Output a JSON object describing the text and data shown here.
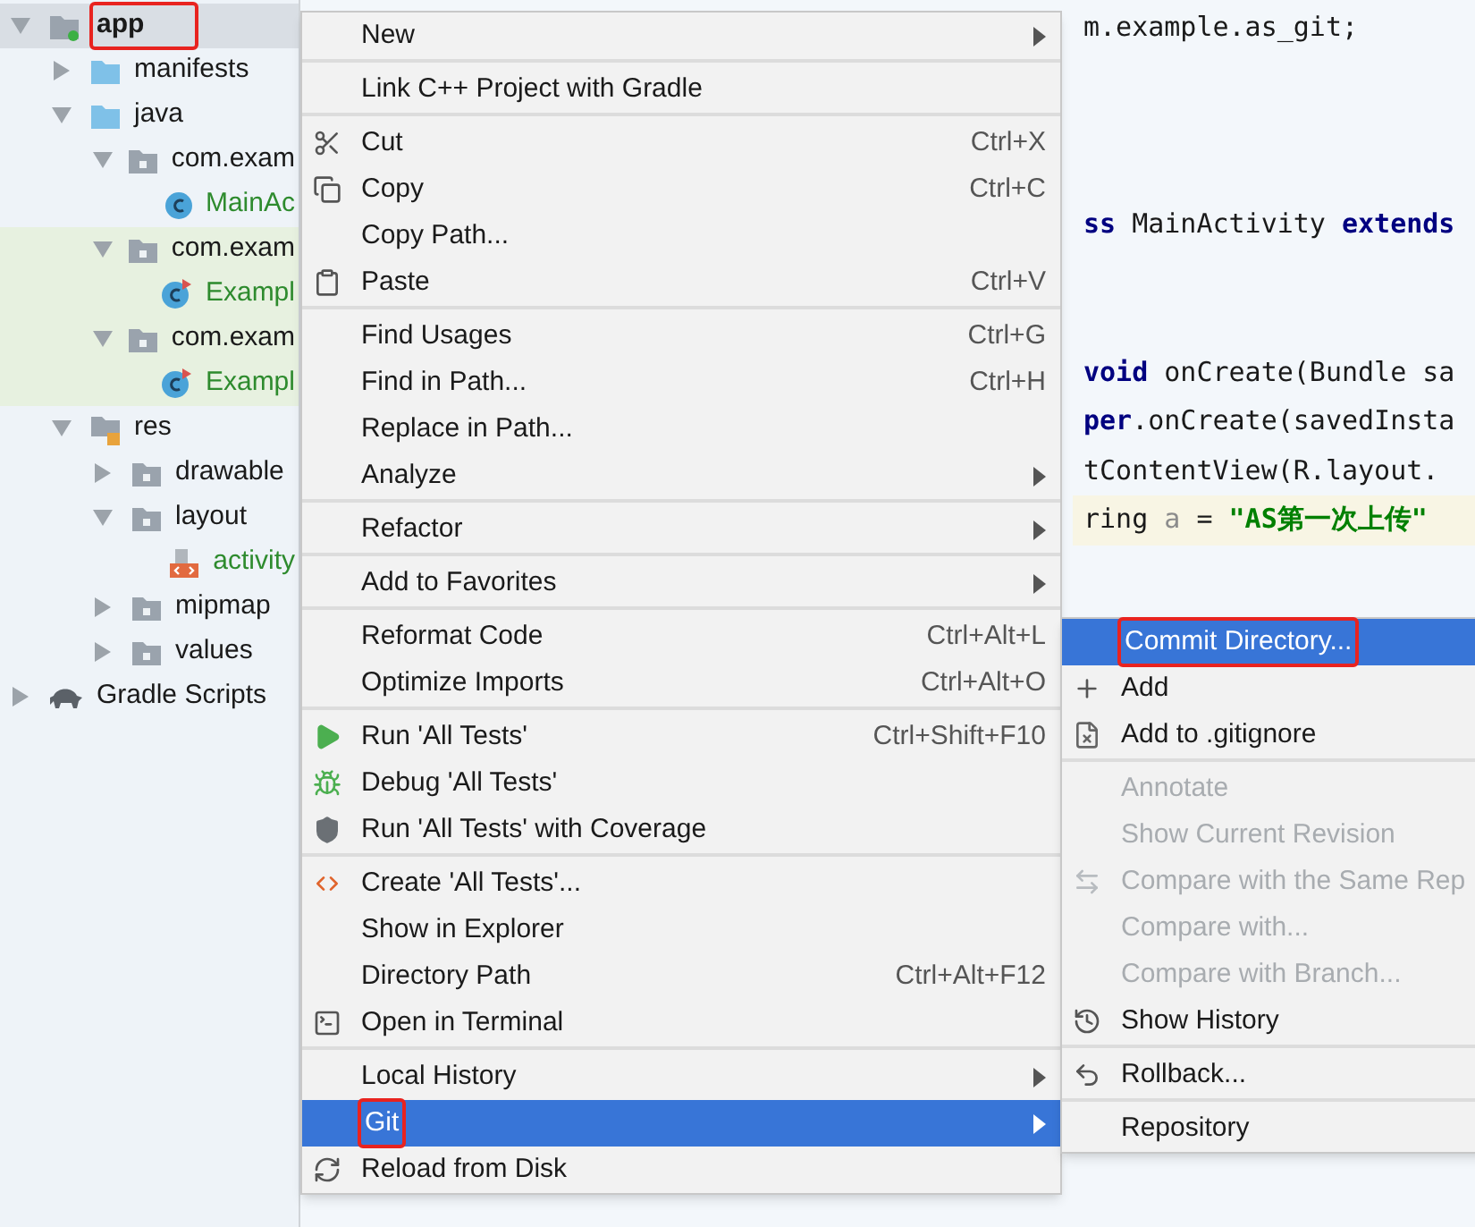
{
  "project_tree": [
    {
      "label": "app",
      "kind": "module",
      "expanded": true,
      "annotated": true,
      "selected": true,
      "children": [
        {
          "label": "manifests",
          "kind": "folder",
          "expanded": false,
          "selected": false
        },
        {
          "label": "java",
          "kind": "folder",
          "expanded": true,
          "selected": false,
          "children": [
            {
              "label": "com.exam",
              "kind": "package",
              "expanded": true,
              "selected": false,
              "children": [
                {
                  "label": "MainAc",
                  "kind": "class",
                  "vcs_added": true,
                  "selected": false
                }
              ]
            },
            {
              "label": "com.exam",
              "kind": "package",
              "expanded": true,
              "test_scope": true,
              "selected": false,
              "children": [
                {
                  "label": "Exampl",
                  "kind": "test-class",
                  "vcs_added": true,
                  "test_scope": true,
                  "selected": false
                }
              ]
            },
            {
              "label": "com.exam",
              "kind": "package",
              "expanded": true,
              "test_scope": true,
              "selected": false,
              "children": [
                {
                  "label": "Exampl",
                  "kind": "test-class",
                  "vcs_added": true,
                  "test_scope": true,
                  "selected": false
                }
              ]
            }
          ]
        },
        {
          "label": "res",
          "kind": "res-folder",
          "expanded": true,
          "selected": false,
          "children": [
            {
              "label": "drawable",
              "kind": "package",
              "expanded": false,
              "selected": false
            },
            {
              "label": "layout",
              "kind": "package",
              "expanded": true,
              "selected": false,
              "children": [
                {
                  "label": "activity",
                  "kind": "layout-file",
                  "vcs_added": true,
                  "selected": false
                }
              ]
            },
            {
              "label": "mipmap",
              "kind": "package",
              "expanded": false,
              "selected": false
            },
            {
              "label": "values",
              "kind": "package",
              "expanded": false,
              "selected": false
            }
          ]
        }
      ]
    },
    {
      "label": "Gradle Scripts",
      "kind": "gradle",
      "expanded": false,
      "selected": false
    }
  ],
  "code_lines": [
    {
      "kind": "code",
      "segments": [
        {
          "text": "m.example.as_git;",
          "kind": "plain"
        }
      ]
    },
    {
      "kind": "blank"
    },
    {
      "kind": "blank"
    },
    {
      "kind": "blank"
    },
    {
      "kind": "code",
      "segments": [
        {
          "text": "ss ",
          "kind": "keyword"
        },
        {
          "text": "MainActivity ",
          "kind": "plain"
        },
        {
          "text": "extends",
          "kind": "keyword"
        }
      ]
    },
    {
      "kind": "blank"
    },
    {
      "kind": "blank"
    },
    {
      "kind": "code",
      "segments": [
        {
          "text": "void ",
          "kind": "keyword"
        },
        {
          "text": "onCreate(Bundle sa",
          "kind": "plain"
        }
      ]
    },
    {
      "kind": "code",
      "segments": [
        {
          "text": "per",
          "kind": "keyword"
        },
        {
          "text": ".onCreate(savedInsta",
          "kind": "plain"
        }
      ]
    },
    {
      "kind": "code",
      "segments": [
        {
          "text": "tContentView(R.layout.",
          "kind": "plain"
        }
      ]
    },
    {
      "kind": "code",
      "current": true,
      "segments": [
        {
          "text": "ring ",
          "kind": "plain"
        },
        {
          "text": "a",
          "kind": "unused"
        },
        {
          "text": " = ",
          "kind": "plain"
        },
        {
          "text": "\"AS第一次上传\"",
          "kind": "string"
        }
      ]
    }
  ],
  "context_menu": [
    [
      {
        "label": "New",
        "kind": "plain",
        "submenu": true,
        "selected": false
      }
    ],
    [
      {
        "label": "Link C++ Project with Gradle",
        "kind": "plain",
        "selected": false
      }
    ],
    [
      {
        "label": "Cut",
        "kind": "cut",
        "shortcut": "Ctrl+X",
        "selected": false
      },
      {
        "label": "Copy",
        "kind": "copy",
        "shortcut": "Ctrl+C",
        "selected": false
      },
      {
        "label": "Copy Path...",
        "kind": "plain",
        "selected": false
      },
      {
        "label": "Paste",
        "kind": "paste",
        "shortcut": "Ctrl+V",
        "selected": false
      }
    ],
    [
      {
        "label": "Find Usages",
        "kind": "plain",
        "shortcut": "Ctrl+G",
        "selected": false
      },
      {
        "label": "Find in Path...",
        "kind": "plain",
        "shortcut": "Ctrl+H",
        "selected": false
      },
      {
        "label": "Replace in Path...",
        "kind": "plain",
        "selected": false
      },
      {
        "label": "Analyze",
        "kind": "plain",
        "submenu": true,
        "selected": false
      }
    ],
    [
      {
        "label": "Refactor",
        "kind": "plain",
        "submenu": true,
        "selected": false
      }
    ],
    [
      {
        "label": "Add to Favorites",
        "kind": "plain",
        "submenu": true,
        "selected": false
      }
    ],
    [
      {
        "label": "Reformat Code",
        "kind": "plain",
        "shortcut": "Ctrl+Alt+L",
        "selected": false
      },
      {
        "label": "Optimize Imports",
        "kind": "plain",
        "shortcut": "Ctrl+Alt+O",
        "selected": false
      }
    ],
    [
      {
        "label": "Run 'All Tests'",
        "kind": "run",
        "shortcut": "Ctrl+Shift+F10",
        "selected": false
      },
      {
        "label": "Debug 'All Tests'",
        "kind": "debug",
        "selected": false
      },
      {
        "label": "Run 'All Tests' with Coverage",
        "kind": "coverage",
        "selected": false
      }
    ],
    [
      {
        "label": "Create 'All Tests'...",
        "kind": "create",
        "selected": false
      },
      {
        "label": "Show in Explorer",
        "kind": "plain",
        "selected": false
      },
      {
        "label": "Directory Path",
        "kind": "plain",
        "shortcut": "Ctrl+Alt+F12",
        "selected": false
      },
      {
        "label": "Open in Terminal",
        "kind": "terminal",
        "selected": false
      }
    ],
    [
      {
        "label": "Local History",
        "kind": "plain",
        "submenu": true,
        "selected": false
      },
      {
        "label": "Git",
        "kind": "plain",
        "submenu": true,
        "selected": true,
        "annotated": true
      },
      {
        "label": "Reload from Disk",
        "kind": "reload",
        "selected": false
      }
    ]
  ],
  "git_submenu": [
    [
      {
        "label": "Commit Directory...",
        "kind": "plain",
        "selected": true,
        "annotated": true,
        "disabled": false
      },
      {
        "label": "Add",
        "kind": "add",
        "selected": false,
        "disabled": false
      },
      {
        "label": "Add to .gitignore",
        "kind": "ignore",
        "selected": false,
        "disabled": false
      }
    ],
    [
      {
        "label": "Annotate",
        "kind": "plain",
        "selected": false,
        "disabled": true
      },
      {
        "label": "Show Current Revision",
        "kind": "plain",
        "selected": false,
        "disabled": true
      },
      {
        "label": "Compare with the Same Rep",
        "kind": "compare",
        "selected": false,
        "disabled": true
      },
      {
        "label": "Compare with...",
        "kind": "plain",
        "selected": false,
        "disabled": true
      },
      {
        "label": "Compare with Branch...",
        "kind": "plain",
        "selected": false,
        "disabled": true
      },
      {
        "label": "Show History",
        "kind": "history",
        "selected": false,
        "disabled": false
      }
    ],
    [
      {
        "label": "Rollback...",
        "kind": "rollback",
        "selected": false,
        "disabled": false
      }
    ],
    [
      {
        "label": "Repository",
        "kind": "plain",
        "selected": false,
        "disabled": false
      }
    ]
  ]
}
